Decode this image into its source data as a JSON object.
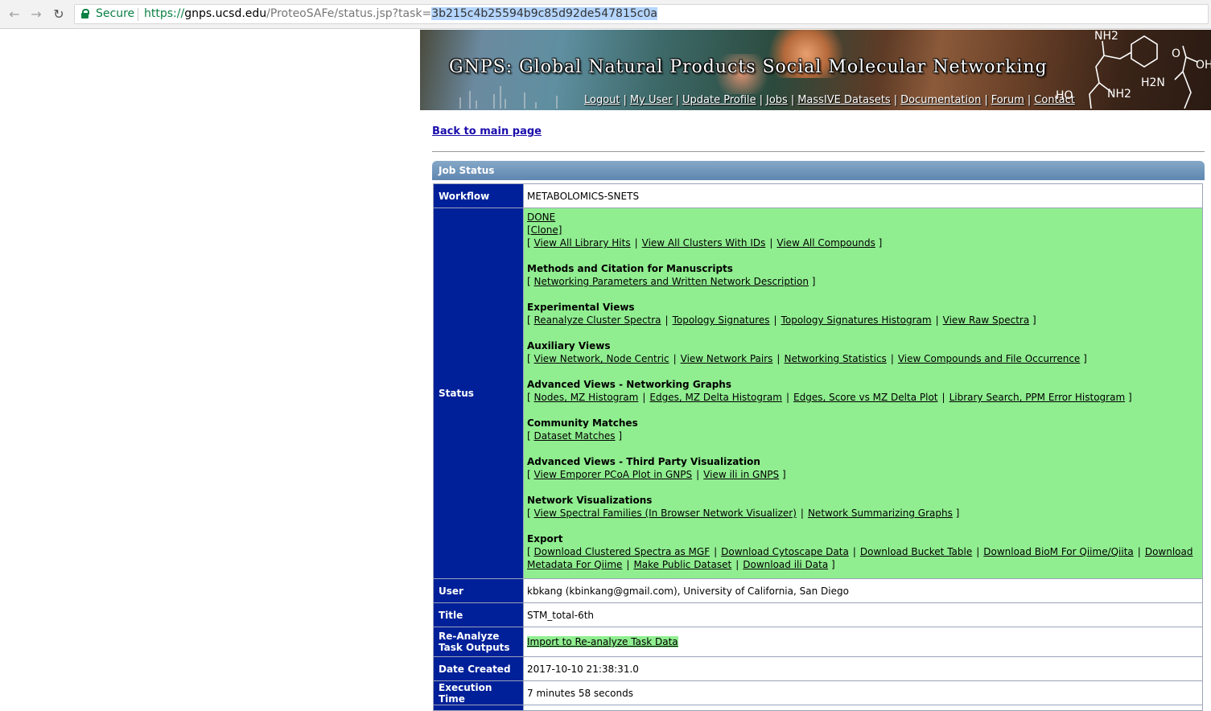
{
  "browser": {
    "secure_label": "Secure",
    "url_scheme": "https://",
    "url_host": "gnps.ucsd.edu",
    "url_path": "/ProteoSAFe/status.jsp?task=",
    "url_task": "3b215c4b25594b9c85d92de547815c0a"
  },
  "banner": {
    "title": "GNPS: Global Natural Products Social Molecular Networking",
    "nav": [
      "Logout",
      "My User",
      "Update Profile",
      "Jobs",
      "MassIVE Datasets",
      "Documentation",
      "Forum",
      "Contact"
    ]
  },
  "back_link": "Back to main page",
  "job_status_header": "Job Status",
  "rows": {
    "workflow_label": "Workflow",
    "workflow_value": "METABOLOMICS-SNETS",
    "status_label": "Status",
    "user_label": "User",
    "user_value": "kbkang (kbinkang@gmail.com), University of California, San Diego",
    "title_label": "Title",
    "title_value": "STM_total-6th",
    "reanalyze_label": "Re-Analyze Task Outputs",
    "reanalyze_link": "Import to Re-analyze Task Data",
    "date_label": "Date Created",
    "date_value": "2017-10-10 21:38:31.0",
    "exec_label": "Execution Time",
    "exec_value": "7 minutes 58 seconds"
  },
  "status": {
    "state": "DONE",
    "clone": "[Clone]",
    "top_links": [
      "View All Library Hits",
      "View All Clusters With IDs",
      "View All Compounds"
    ],
    "sections": [
      {
        "title": "Methods and Citation for Manuscripts",
        "links": [
          "Networking Parameters and Written Network Description"
        ]
      },
      {
        "title": "Experimental Views",
        "links": [
          "Reanalyze Cluster Spectra",
          "Topology Signatures",
          "Topology Signatures Histogram",
          "View Raw Spectra"
        ]
      },
      {
        "title": "Auxiliary Views",
        "links": [
          "View Network, Node Centric",
          "View Network Pairs",
          "Networking Statistics",
          "View Compounds and File Occurrence"
        ]
      },
      {
        "title": "Advanced Views - Networking Graphs",
        "links": [
          "Nodes, MZ Histogram",
          "Edges, MZ Delta Histogram",
          "Edges, Score vs MZ Delta Plot",
          "Library Search, PPM Error Histogram"
        ]
      },
      {
        "title": "Community Matches",
        "links": [
          "Dataset Matches"
        ]
      },
      {
        "title": "Advanced Views - Third Party Visualization",
        "links": [
          "View Emporer PCoA Plot in GNPS",
          "View ili in GNPS"
        ]
      },
      {
        "title": "Network Visualizations",
        "links": [
          "View Spectral Families (In Browser Network Visualizer)",
          "Network Summarizing Graphs"
        ]
      },
      {
        "title": "Export",
        "links": [
          "Download Clustered Spectra as MGF",
          "Download Cytoscape Data",
          "Download Bucket Table",
          "Download BioM For Qiime/Qiita",
          "Download Metadata For Qiime",
          "Make Public Dataset",
          "Download ili Data"
        ]
      }
    ]
  },
  "chem_labels": {
    "nh2_top": "NH2",
    "nh2_mid": "NH2",
    "h2n": "H2N",
    "ho": "HO",
    "oh": "OH",
    "o": "O"
  },
  "icons": {
    "back": "back-arrow-icon",
    "forward": "forward-arrow-icon",
    "reload": "reload-icon",
    "lock": "lock-icon"
  }
}
